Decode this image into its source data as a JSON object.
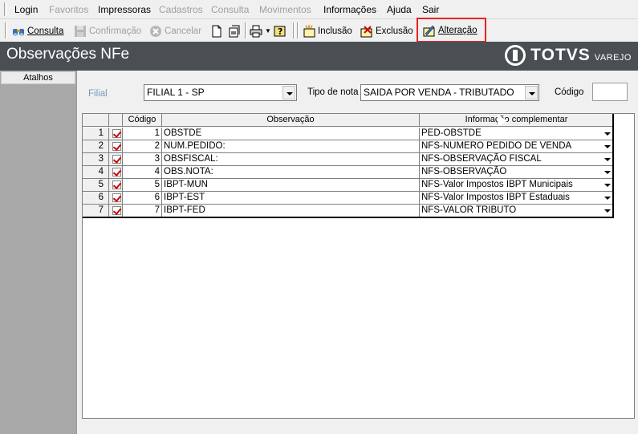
{
  "menu": {
    "items": [
      {
        "label": "Login",
        "enabled": true
      },
      {
        "label": "Favoritos",
        "enabled": false
      },
      {
        "label": "Impressoras",
        "enabled": true
      },
      {
        "label": "Cadastros",
        "enabled": false
      },
      {
        "label": "Consulta",
        "enabled": false
      },
      {
        "label": "Movimentos",
        "enabled": false
      },
      {
        "label": "Informações",
        "enabled": true
      },
      {
        "label": "Ajuda",
        "enabled": true
      },
      {
        "label": "Sair",
        "enabled": true
      }
    ]
  },
  "toolbar": {
    "consulta": "Consulta",
    "confirmacao": "Confirmação",
    "cancelar": "Cancelar",
    "inclusao": "Inclusão",
    "exclusao": "Exclusão",
    "alteracao": "Alteração",
    "highlight_color": "#e32424"
  },
  "header": {
    "title": "Observações NFe",
    "brand": "TOTVS",
    "brand_sub": "VAREJO",
    "bg_color": "#4a4f54"
  },
  "sidebar": {
    "title": "Atalhos"
  },
  "filters": {
    "filial_label": "Filial",
    "filial_value": "FILIAL 1 - SP",
    "tipo_label": "Tipo de nota",
    "tipo_value": "SAIDA POR VENDA - TRIBUTADO",
    "codigo_label": "Código",
    "codigo_value": ""
  },
  "grid": {
    "columns": [
      "Código",
      "Observação",
      "Informação complementar"
    ],
    "rows": [
      {
        "row": "1",
        "codigo": "1",
        "observacao": "OBSTDE",
        "info": "PED-OBSTDE"
      },
      {
        "row": "2",
        "codigo": "2",
        "observacao": "NUM.PEDIDO:",
        "info": "NFS-NUMERO PEDIDO DE VENDA"
      },
      {
        "row": "3",
        "codigo": "3",
        "observacao": "OBSFISCAL:",
        "info": "NFS-OBSERVAÇÃO FISCAL"
      },
      {
        "row": "4",
        "codigo": "4",
        "observacao": "OBS.NOTA:",
        "info": "NFS-OBSERVAÇÃO"
      },
      {
        "row": "5",
        "codigo": "5",
        "observacao": "IBPT-MUN",
        "info": "NFS-Valor Impostos IBPT Municipais"
      },
      {
        "row": "6",
        "codigo": "6",
        "observacao": "IBPT-EST",
        "info": "NFS-Valor Impostos IBPT Estaduais"
      },
      {
        "row": "7",
        "codigo": "7",
        "observacao": "IBPT-FED",
        "info": "NFS-VALOR TRIBUTO"
      }
    ]
  }
}
